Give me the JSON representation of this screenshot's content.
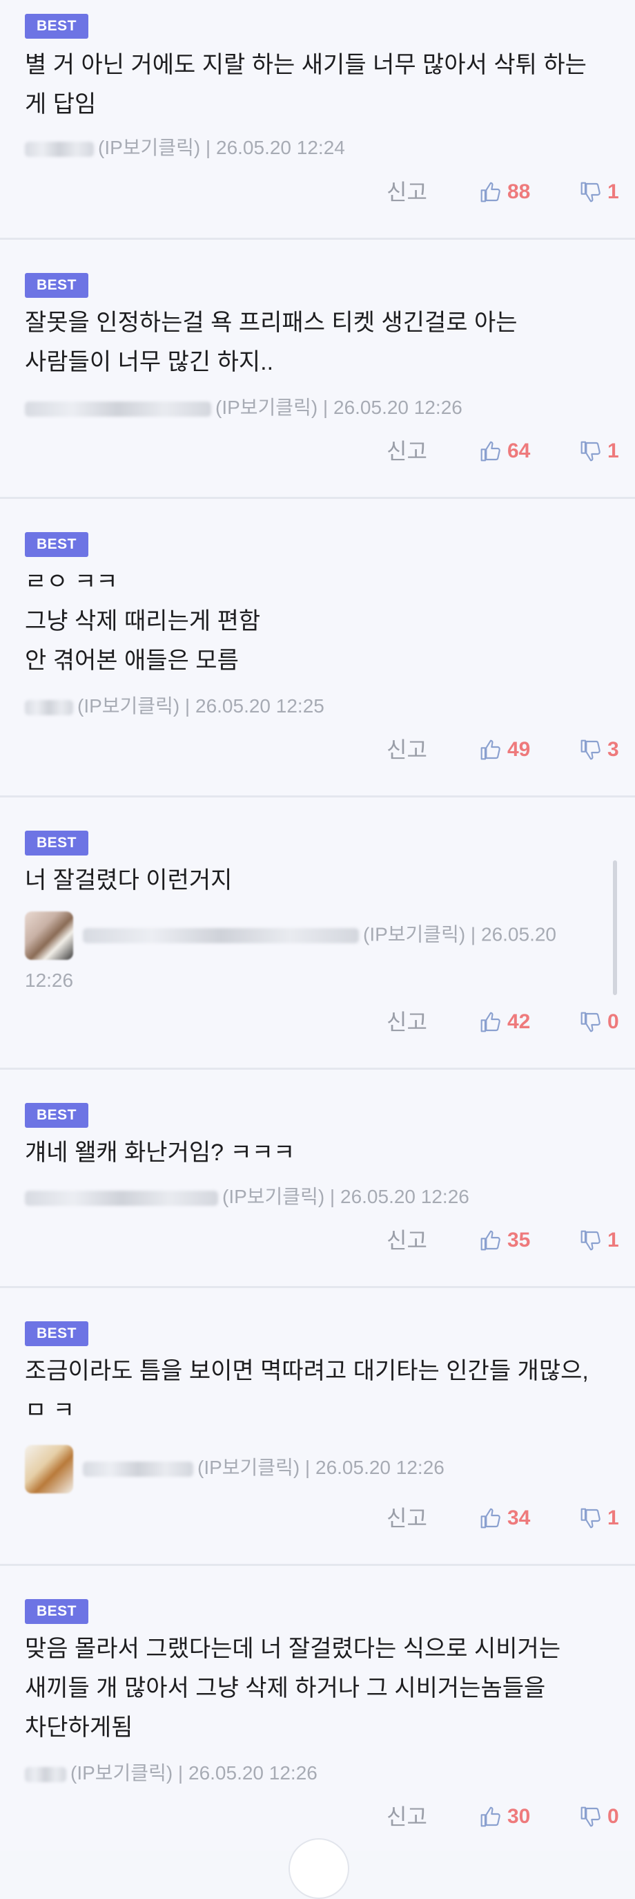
{
  "labels": {
    "report": "신고"
  },
  "colors": {
    "badge": "#6d74e4",
    "count": "#ee7a7c",
    "icon": "#8aa0cf"
  },
  "icons": {
    "like": "thumbs-up-icon",
    "dislike": "thumbs-down-icon"
  },
  "comments": [
    {
      "badge": "BEST",
      "text": "별 거 아닌 거에도 지랄 하는 새기들 너무 많아서 삭튀 하는 게 답임",
      "ip": "IP보기클릭",
      "date": "26.05.20 12:24",
      "likes": "88",
      "dislikes": "1"
    },
    {
      "badge": "BEST",
      "text": "잘못을 인정하는걸 욕 프리패스 티켓 생긴걸로 아는 사람들이 너무 많긴 하지..",
      "ip": "IP보기클릭",
      "date": "26.05.20 12:26",
      "likes": "64",
      "dislikes": "1"
    },
    {
      "badge": "BEST",
      "text": "ㄹㅇ ㅋㅋ\n그냥 삭제 때리는게 편함\n안 겪어본 애들은 모름",
      "ip": "IP보기클릭",
      "date": "26.05.20 12:25",
      "likes": "49",
      "dislikes": "3"
    },
    {
      "badge": "BEST",
      "text": "너 잘걸렸다 이런거지",
      "ip": "IP보기클릭",
      "date": "26.05.20 12:26",
      "likes": "42",
      "dislikes": "0"
    },
    {
      "badge": "BEST",
      "text": "걔네 왤캐 화난거임? ㅋㅋㅋ",
      "ip": "IP보기클릭",
      "date": "26.05.20 12:26",
      "likes": "35",
      "dislikes": "1"
    },
    {
      "badge": "BEST",
      "text": "조금이라도 틈을 보이면 멱따려고 대기타는 인간들 개많으,ㅁ ㅋ",
      "ip": "IP보기클릭",
      "date": "26.05.20 12:26",
      "likes": "34",
      "dislikes": "1"
    },
    {
      "badge": "BEST",
      "text": "맞음 몰라서 그랬다는데 너 잘걸렸다는 식으로 시비거는 새끼들 개 많아서 그냥 삭제 하거나 그 시비거는놈들을 차단하게됨",
      "ip": "IP보기클릭",
      "date": "26.05.20 12:26",
      "likes": "30",
      "dislikes": "0"
    }
  ]
}
